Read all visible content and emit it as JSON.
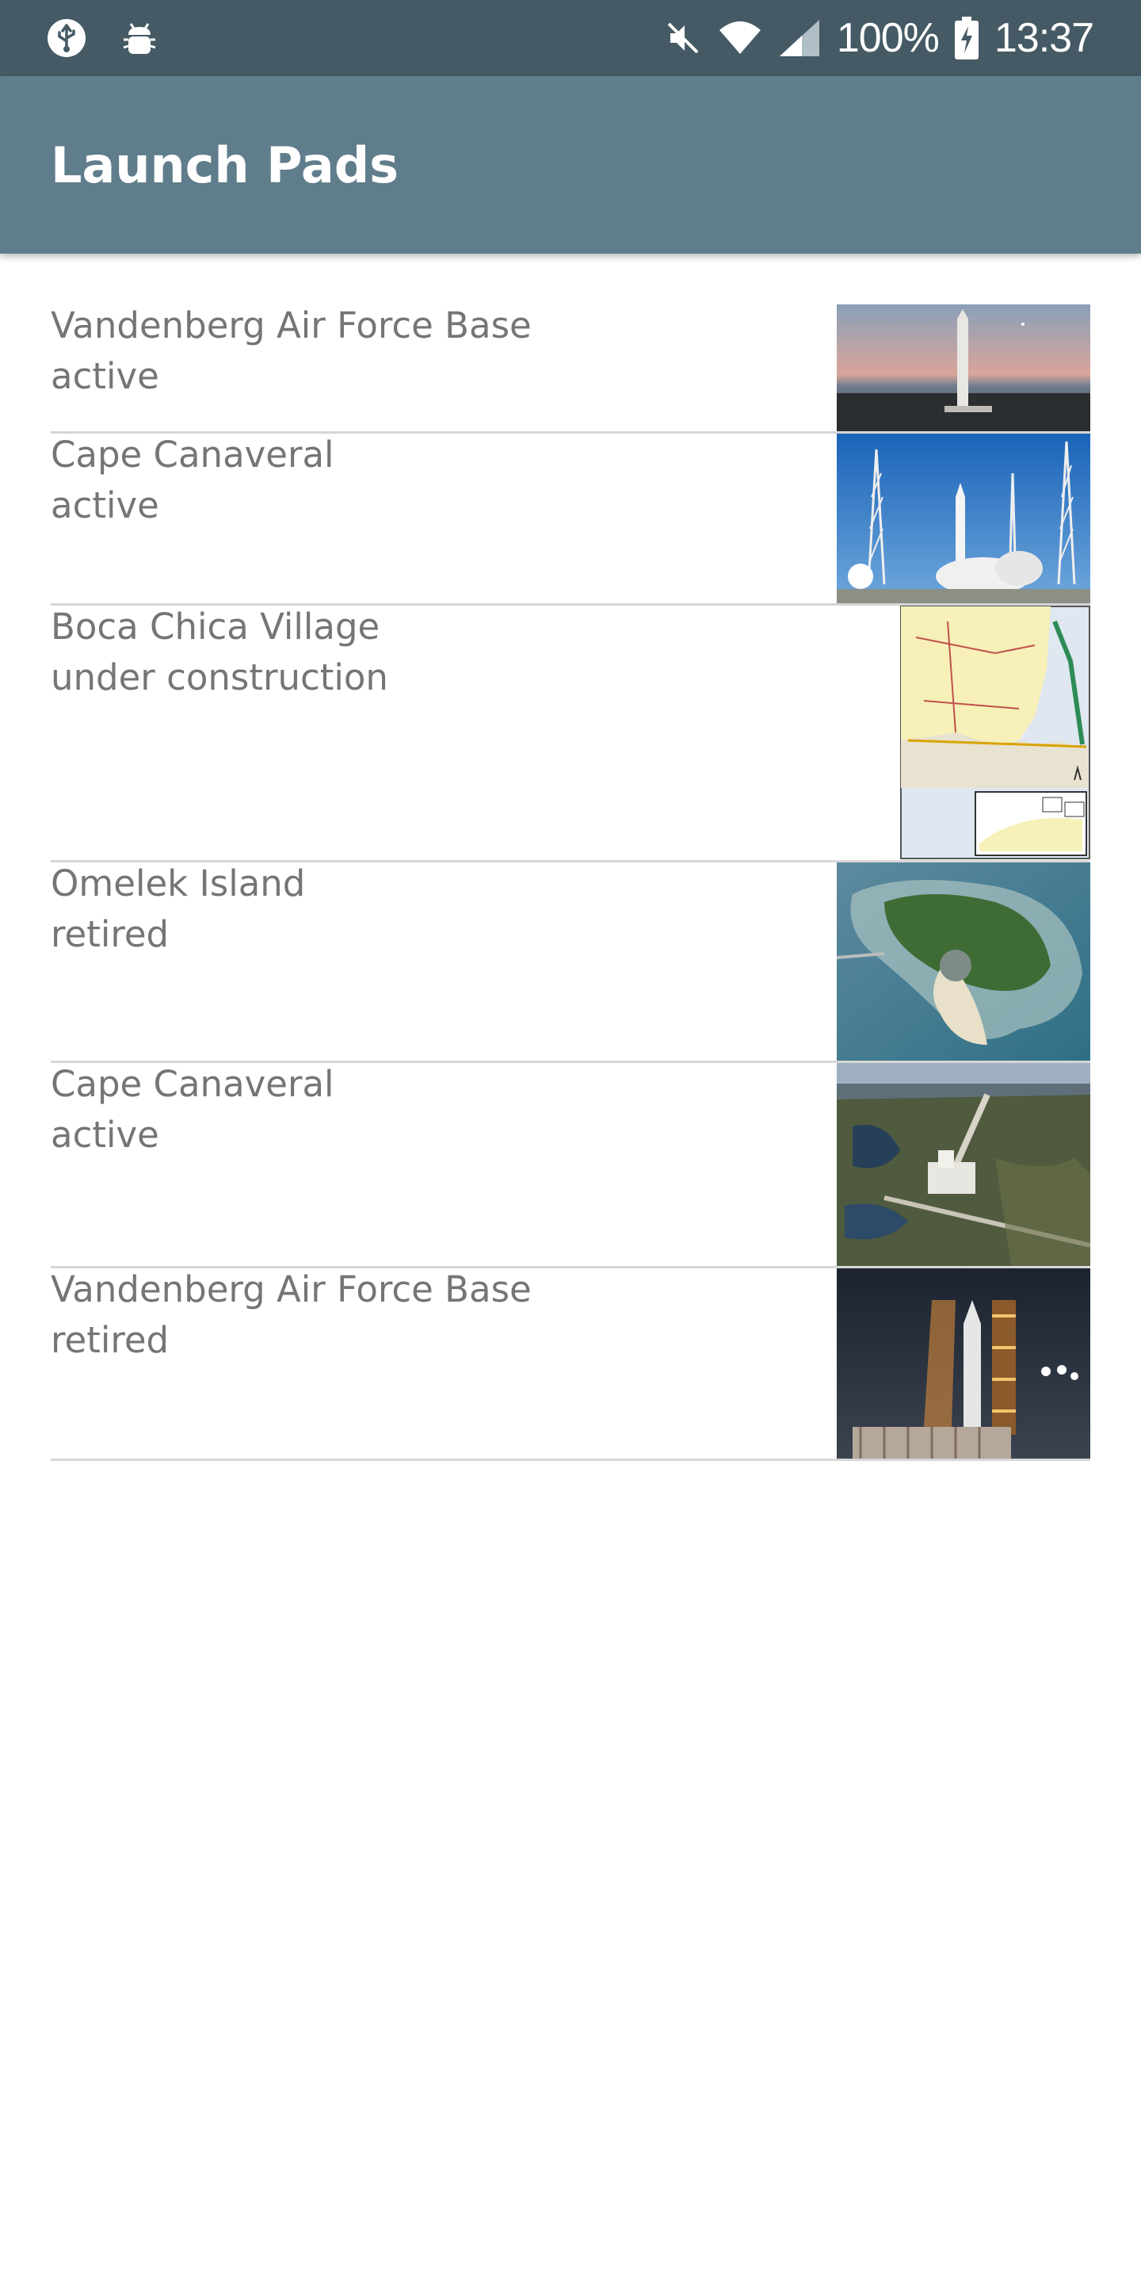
{
  "status_bar": {
    "battery": "100%",
    "time": "13:37",
    "icons": [
      "usb-icon",
      "android-debug-icon",
      "mute-icon",
      "wifi-icon",
      "signal-icon",
      "battery-charging-icon"
    ]
  },
  "app_bar": {
    "title": "Launch Pads"
  },
  "pads": [
    {
      "name": "Vandenberg Air Force Base",
      "status": "active",
      "image": "rocket-on-coastal-pad-dusk"
    },
    {
      "name": "Cape Canaveral",
      "status": "active",
      "image": "rocket-launch-with-towers"
    },
    {
      "name": "Boca Chica Village",
      "status": "under construction",
      "image": "texas-map"
    },
    {
      "name": "Omelek Island",
      "status": "retired",
      "image": "aerial-island"
    },
    {
      "name": "Cape Canaveral",
      "status": "active",
      "image": "aerial-launch-complex"
    },
    {
      "name": "Vandenberg Air Force Base",
      "status": "retired",
      "image": "rocket-on-pad-night"
    }
  ]
}
